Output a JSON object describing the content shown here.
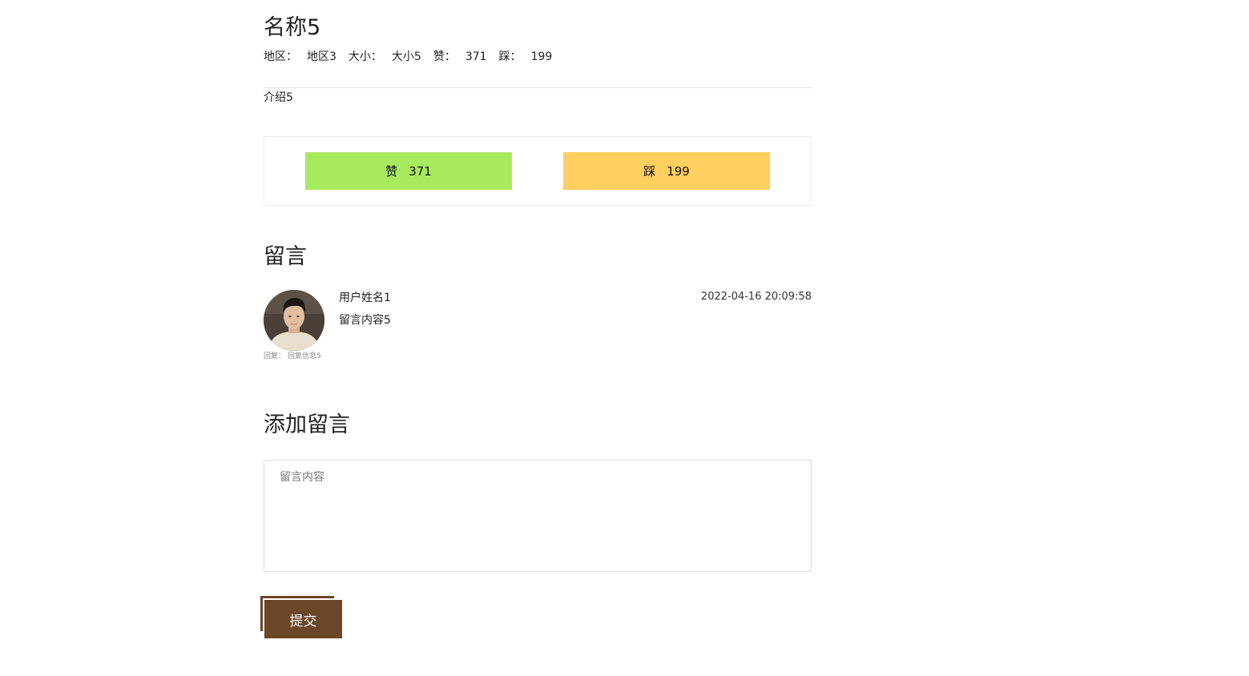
{
  "item": {
    "name": "名称5",
    "meta": {
      "region_label": "地区：",
      "region_value": "地区3",
      "size_label": "大小：",
      "size_value": "大小5",
      "likes_label": "赞：",
      "likes_value": "371",
      "dislikes_label": "踩：",
      "dislikes_value": "199"
    },
    "intro": "介绍5"
  },
  "votes": {
    "like_label": "赞",
    "like_count": "371",
    "dislike_label": "踩",
    "dislike_count": "199",
    "like_color": "#a8ea5d",
    "dislike_color": "#ffcf5f"
  },
  "comments": {
    "title": "留言",
    "items": [
      {
        "username": "用户姓名1",
        "content": "留言内容5",
        "timestamp": "2022-04-16 20:09:58",
        "reply_label": "回复：",
        "reply_text": "回复信息5",
        "avatar_icon": "user-avatar-icon"
      }
    ]
  },
  "add_comment": {
    "title": "添加留言",
    "placeholder": "留言内容",
    "value": "",
    "submit_label": "提交",
    "submit_color": "#6b4628"
  }
}
